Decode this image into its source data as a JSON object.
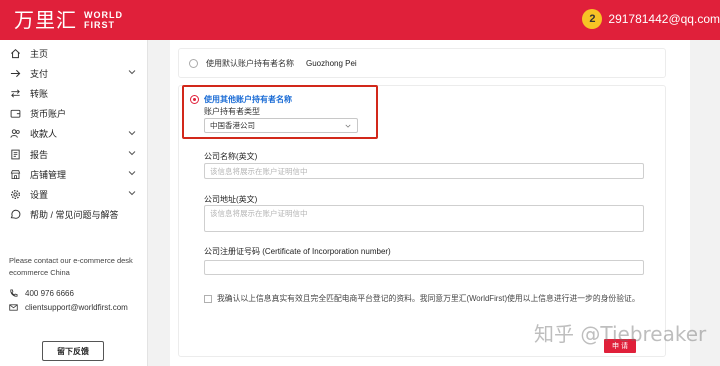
{
  "header": {
    "logo_cn": "万里汇",
    "logo_en_line1": "WORLD",
    "logo_en_line2": "FIRST",
    "notification_count": "2",
    "user_email": "291781442@qq.com"
  },
  "sidebar": {
    "items": [
      {
        "label": "主页",
        "icon": "home-icon",
        "has_chevron": false
      },
      {
        "label": "支付",
        "icon": "arrow-right-icon",
        "has_chevron": true
      },
      {
        "label": "转账",
        "icon": "transfer-icon",
        "has_chevron": false
      },
      {
        "label": "货币账户",
        "icon": "wallet-icon",
        "has_chevron": false
      },
      {
        "label": "收款人",
        "icon": "users-icon",
        "has_chevron": true
      },
      {
        "label": "报告",
        "icon": "report-icon",
        "has_chevron": true
      },
      {
        "label": "店铺管理",
        "icon": "store-icon",
        "has_chevron": true
      },
      {
        "label": "设置",
        "icon": "gear-icon",
        "has_chevron": true
      },
      {
        "label": "帮助 / 常见问题与解答",
        "icon": "help-icon",
        "has_chevron": false
      }
    ],
    "contact_note": "Please contact our e-commerce desk ecommerce China",
    "phone": "400 976 6666",
    "email": "clientsupport@worldfirst.com",
    "feedback_label": "留下反馈"
  },
  "form": {
    "option_default_label": "使用默认账户持有者名称",
    "option_default_name": "Guozhong Pei",
    "option_other_label": "使用其他账户持有者名称",
    "holder_type_label": "账户持有者类型",
    "holder_type_value": "中国香港公司",
    "company_name_label": "公司名称(英文)",
    "company_name_placeholder": "该信息将展示在账户证明信中",
    "company_address_label": "公司地址(英文)",
    "company_address_placeholder": "该信息将展示在账户证明信中",
    "registration_label": "公司注册证号码 (Certificate of Incorporation number)",
    "registration_placeholder": "",
    "confirm_text": "我确认以上信息真实有效且完全匹配电商平台登记的资料。我同意万里汇(WorldFirst)使用以上信息进行进一步的身份验证。",
    "submit_label": "申 请"
  },
  "watermark": "知乎 @Tiebreaker",
  "colors": {
    "brand_red": "#e0203a",
    "highlight_border": "#d2281a",
    "selected_option_text": "#1e6ed6",
    "badge_yellow": "#f7c325"
  }
}
